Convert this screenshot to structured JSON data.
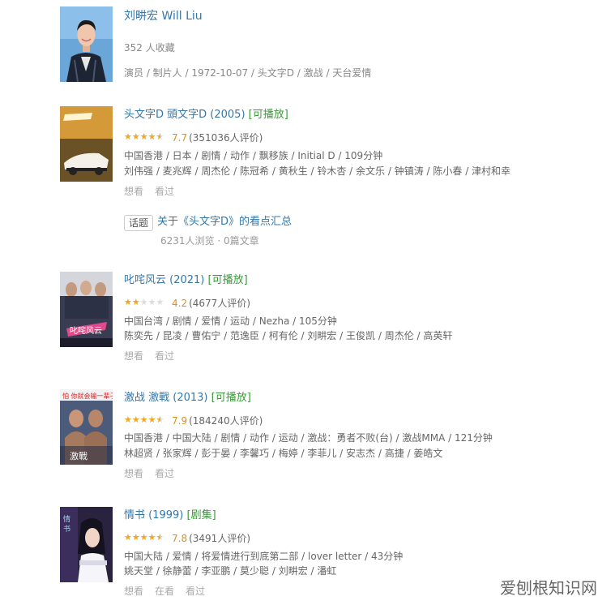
{
  "person": {
    "name": "刘畊宏 Will Liu",
    "collect": "352 人收藏",
    "meta": "演员 / 制片人 / 1972-10-07 / 头文字D / 激战 / 天台爱情"
  },
  "movies": [
    {
      "title": "头文字D 頭文字D (2005)",
      "badge": "[可播放]",
      "stars": 4,
      "score": "7.7",
      "votes": "(351036人评价)",
      "info1": "中国香港 / 日本 / 剧情 / 动作 / 飘移族 / Initial D / 109分钟",
      "info2": "刘伟强 / 麦兆辉 / 周杰伦 / 陈冠希 / 黄秋生 / 铃木杏 / 余文乐 / 钟镇涛 / 陈小春 / 津村和幸",
      "actions": [
        "想看",
        "看过"
      ]
    },
    {
      "title": "叱咤风云 (2021)",
      "badge": "[可播放]",
      "stars": 2,
      "score": "4.2",
      "votes": "(4677人评价)",
      "info1": "中国台湾 / 剧情 / 爱情 / 运动 / Nezha / 105分钟",
      "info2": "陈奕先 / 昆凌 / 曹佑宁 / 范逸臣 / 柯有伦 / 刘畊宏 / 王俊凯 / 周杰伦 / 高英轩",
      "actions": [
        "想看",
        "看过"
      ]
    },
    {
      "title": "激战 激戰 (2013)",
      "badge": "[可播放]",
      "stars": 4,
      "score": "7.9",
      "votes": "(184240人评价)",
      "info1": "中国香港 / 中国大陆 / 剧情 / 动作 / 运动 / 激战：勇者不败(台) / 激战MMA / 121分钟",
      "info2": "林超贤 / 张家辉 / 彭于晏 / 李馨巧 / 梅婷 / 李菲儿 / 安志杰 / 高捷 / 姜皓文",
      "actions": [
        "想看",
        "看过"
      ]
    },
    {
      "title": "情书 (1999)",
      "badge": "[剧集]",
      "stars": 4,
      "score": "7.8",
      "votes": "(3491人评价)",
      "info1": "中国大陆 / 爱情 / 将爱情进行到底第二部 / lover letter / 43分钟",
      "info2": "姚天堂 / 徐静蕾 / 李亚鹏 / 莫少聪 / 刘畊宏 / 潘虹",
      "actions": [
        "想看",
        "在看",
        "看过"
      ]
    }
  ],
  "topic": {
    "tag": "话题",
    "title": "关于《头文字D》的看点汇总",
    "meta": "6231人浏览 · 0篇文章"
  },
  "watermark": "爱刨根知识网",
  "colors": {
    "link": "#3377aa",
    "play": "#3a9a3a",
    "star": "#f4a81e",
    "muted": "#aaaaaa"
  }
}
